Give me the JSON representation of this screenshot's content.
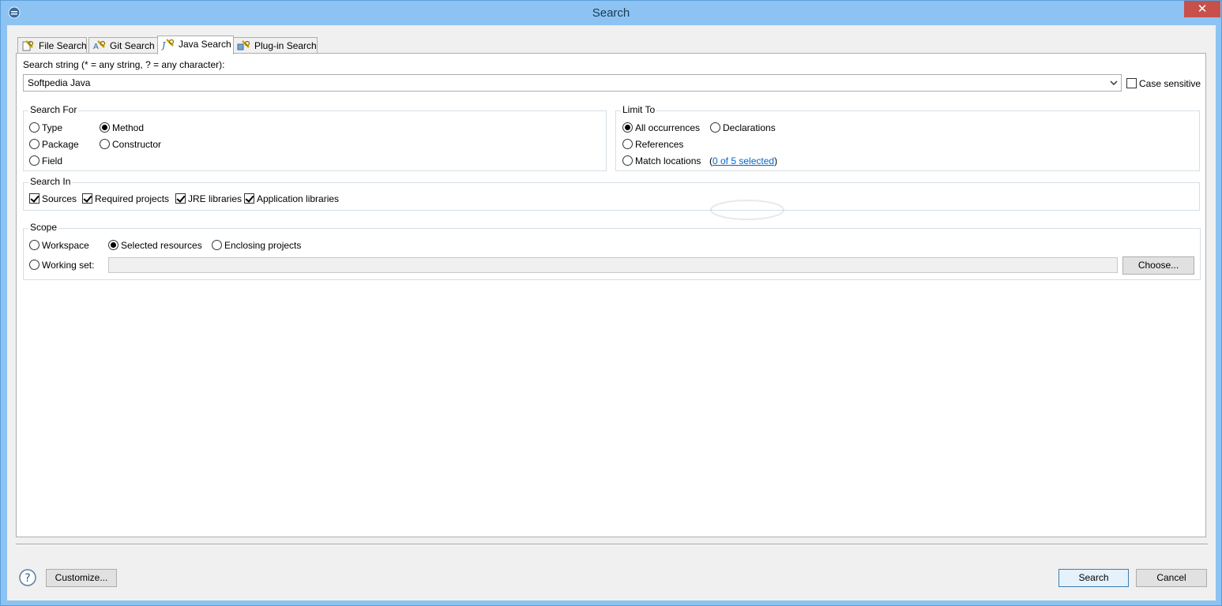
{
  "window": {
    "title": "Search",
    "close_label": "✕"
  },
  "tabs": [
    {
      "label": "File Search",
      "icon": "file-search-icon"
    },
    {
      "label": "Git Search",
      "icon": "git-search-icon"
    },
    {
      "label": "Java Search",
      "icon": "java-search-icon",
      "active": true
    },
    {
      "label": "Plug-in Search",
      "icon": "plugin-search-icon"
    }
  ],
  "search_string": {
    "label": "Search string (* = any string, ? = any character):",
    "value": "Softpedia Java",
    "case_sensitive_label": "Case sensitive",
    "case_sensitive": false
  },
  "search_for": {
    "title": "Search For",
    "options": {
      "type": "Type",
      "method": "Method",
      "package": "Package",
      "constructor": "Constructor",
      "field": "Field"
    },
    "selected": "Method"
  },
  "limit_to": {
    "title": "Limit To",
    "options": {
      "all": "All occurrences",
      "declarations": "Declarations",
      "references": "References",
      "match": "Match locations"
    },
    "selected": "All occurrences",
    "match_link": "0 of 5 selected",
    "paren_open": "(",
    "paren_close": ")"
  },
  "search_in": {
    "title": "Search In",
    "items": {
      "sources": "Sources",
      "required": "Required projects",
      "jre": "JRE libraries",
      "app": "Application libraries"
    }
  },
  "scope": {
    "title": "Scope",
    "options": {
      "workspace": "Workspace",
      "selected": "Selected resources",
      "enclosing": "Enclosing projects",
      "working_set": "Working set:"
    },
    "selected": "Selected resources",
    "working_set_value": "",
    "choose_label": "Choose..."
  },
  "footer": {
    "customize_label": "Customize...",
    "search_label": "Search",
    "cancel_label": "Cancel",
    "help_icon": "help-icon"
  }
}
